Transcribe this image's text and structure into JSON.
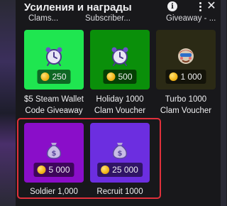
{
  "header": {
    "title": "Усиления и награды",
    "info_icon": "info-icon",
    "more_icon": "more-vertical-icon",
    "close_icon": "close-icon",
    "close_glyph": "✕"
  },
  "previous_row": [
    "Clams...",
    "Subscriber...",
    "Giveaway - ..."
  ],
  "rewards": [
    {
      "title_lines": [
        "$5 Steam Wallet",
        "Code Giveaway"
      ],
      "price": "250",
      "bg_color": "#1fe650",
      "icon": "alarm-clock-icon"
    },
    {
      "title_lines": [
        "Holiday 1000",
        "Clam Voucher"
      ],
      "price": "500",
      "bg_color": "#0a8f0a",
      "icon": "alarm-clock-icon"
    },
    {
      "title_lines": [
        "Turbo 1000",
        "Clam Voucher"
      ],
      "price": "1 000",
      "bg_color": "#2b2a15",
      "icon": "custom-avatar-icon"
    },
    {
      "title_lines": [
        "Soldier 1,000"
      ],
      "price": "5 000",
      "bg_color": "#8a0ec9",
      "icon": "money-bag-icon"
    },
    {
      "title_lines": [
        "Recruit 1000"
      ],
      "price": "25 000",
      "bg_color": "#6c2ee0",
      "icon": "money-bag-icon"
    }
  ],
  "colors": {
    "panel_bg": "#18181b",
    "highlight_border": "#e0303b",
    "coin": "#f2b81c"
  }
}
